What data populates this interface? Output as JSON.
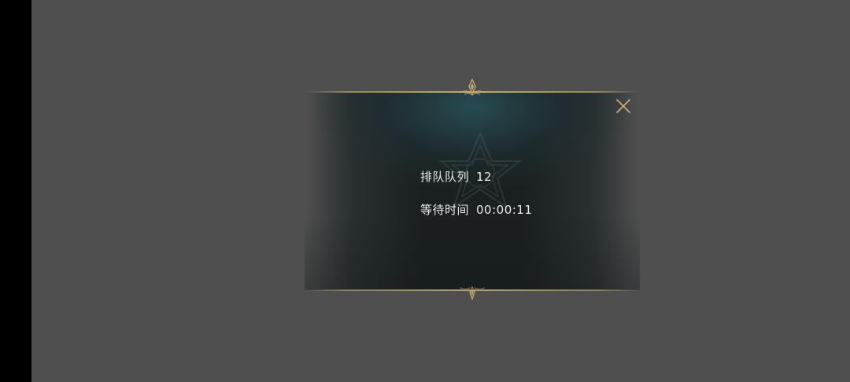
{
  "queue": {
    "label": "排队队列",
    "value": "12"
  },
  "wait": {
    "label": "等待时间",
    "value": "00:00:11"
  },
  "colors": {
    "gold": "#c9ac6e",
    "text": "#eaeaea",
    "panel_dark": "#1a1f21",
    "panel_teal": "#284e54",
    "backdrop": "#4f4f4f"
  },
  "icons": {
    "close": "close-icon",
    "ornament_top": "gold-ornament-icon",
    "ornament_bottom": "gold-ornament-icon",
    "emblem": "star-emblem-icon"
  }
}
